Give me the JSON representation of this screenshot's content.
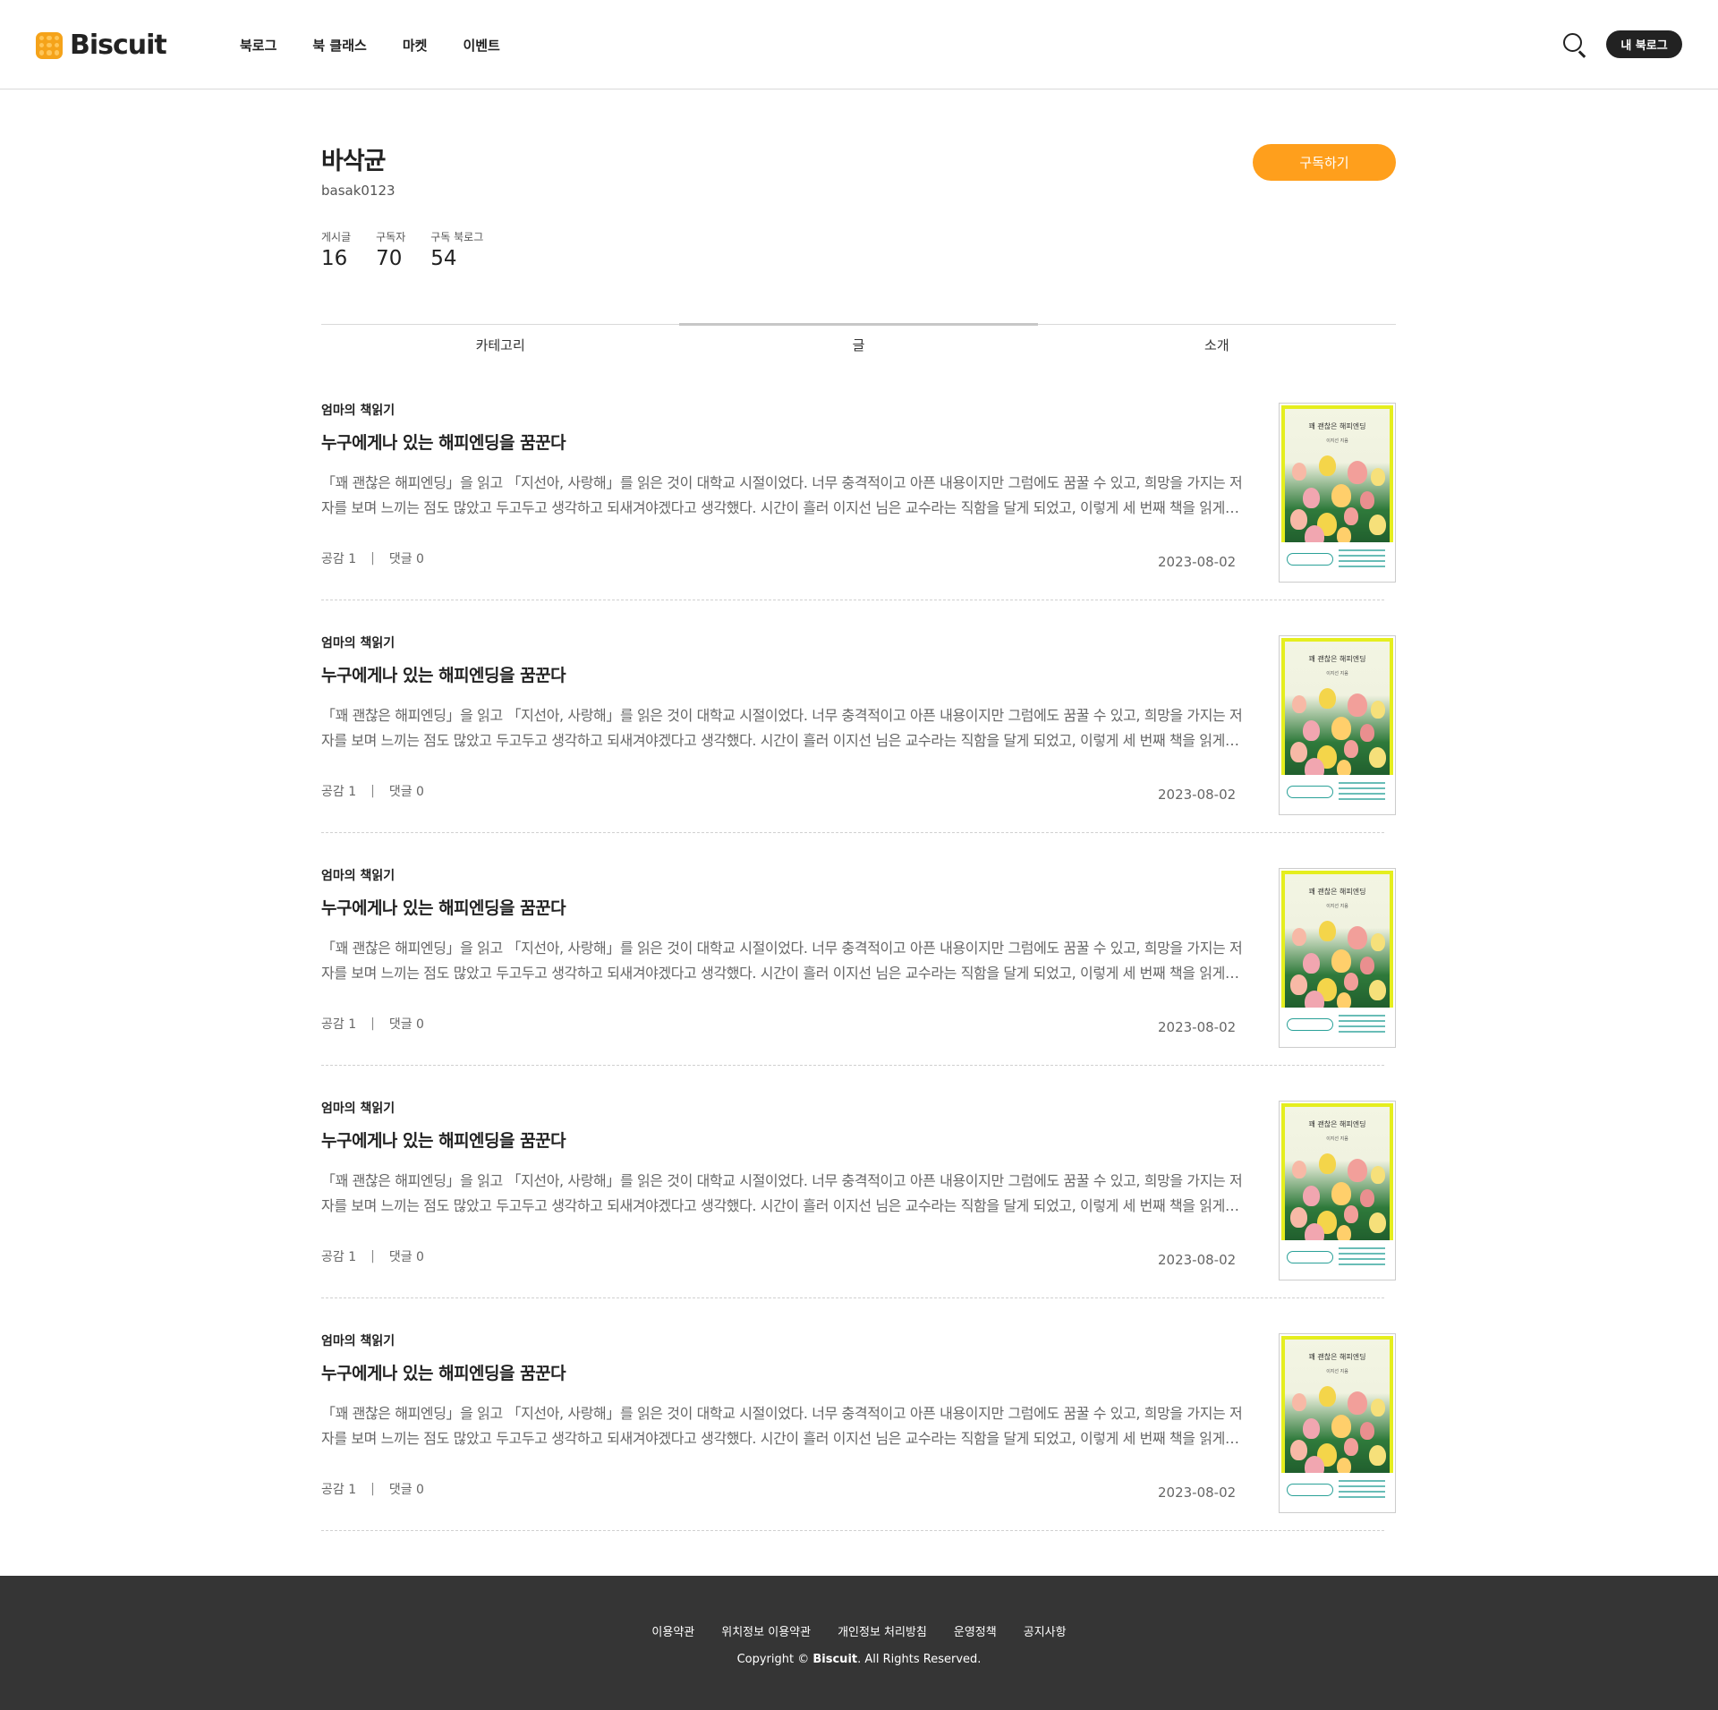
{
  "header": {
    "logo_text": "Biscuit",
    "nav": [
      "북로그",
      "북 클래스",
      "마켓",
      "이벤트"
    ],
    "my_booklog": "내 북로그"
  },
  "profile": {
    "name": "바삭균",
    "id": "basak0123",
    "subscribe_label": "구독하기",
    "stats": [
      {
        "label": "게시글",
        "value": "16"
      },
      {
        "label": "구독자",
        "value": "70"
      },
      {
        "label": "구독 북로그",
        "value": "54"
      }
    ]
  },
  "tabs": [
    {
      "label": "카테고리",
      "active": false
    },
    {
      "label": "글",
      "active": true
    },
    {
      "label": "소개",
      "active": false
    }
  ],
  "posts": [
    {
      "category": "엄마의 책읽기",
      "title": "누구에게나 있는 해피엔딩을 꿈꾼다",
      "excerpt": "「꽤 괜찮은 해피엔딩」을 읽고 「지선아, 사랑해」를 읽은 것이 대학교 시절이었다. 너무 충격적이고 아픈 내용이지만 그럼에도 꿈꿀 수 있고, 희망을 가지는 저자를 보며 느끼는 점도 많았고 두고두고 생각하고 되새겨야겠다고 생각했다. 시간이 흘러 이지선 님은 교수라는 직함을 달게 되었고, 이렇게 세 번째 책을 읽게 되었다.",
      "likes": "공감 1",
      "comments": "댓글 0",
      "date": "2023-08-02"
    },
    {
      "category": "엄마의 책읽기",
      "title": "누구에게나 있는 해피엔딩을 꿈꾼다",
      "excerpt": "「꽤 괜찮은 해피엔딩」을 읽고 「지선아, 사랑해」를 읽은 것이 대학교 시절이었다. 너무 충격적이고 아픈 내용이지만 그럼에도 꿈꿀 수 있고, 희망을 가지는 저자를 보며 느끼는 점도 많았고 두고두고 생각하고 되새겨야겠다고 생각했다. 시간이 흘러 이지선 님은 교수라는 직함을 달게 되었고, 이렇게 세 번째 책을 읽게 되었다.",
      "likes": "공감 1",
      "comments": "댓글 0",
      "date": "2023-08-02"
    },
    {
      "category": "엄마의 책읽기",
      "title": "누구에게나 있는 해피엔딩을 꿈꾼다",
      "excerpt": "「꽤 괜찮은 해피엔딩」을 읽고 「지선아, 사랑해」를 읽은 것이 대학교 시절이었다. 너무 충격적이고 아픈 내용이지만 그럼에도 꿈꿀 수 있고, 희망을 가지는 저자를 보며 느끼는 점도 많았고 두고두고 생각하고 되새겨야겠다고 생각했다. 시간이 흘러 이지선 님은 교수라는 직함을 달게 되었고, 이렇게 세 번째 책을 읽게 되었다.",
      "likes": "공감 1",
      "comments": "댓글 0",
      "date": "2023-08-02"
    },
    {
      "category": "엄마의 책읽기",
      "title": "누구에게나 있는 해피엔딩을 꿈꾼다",
      "excerpt": "「꽤 괜찮은 해피엔딩」을 읽고 「지선아, 사랑해」를 읽은 것이 대학교 시절이었다. 너무 충격적이고 아픈 내용이지만 그럼에도 꿈꿀 수 있고, 희망을 가지는 저자를 보며 느끼는 점도 많았고 두고두고 생각하고 되새겨야겠다고 생각했다. 시간이 흘러 이지선 님은 교수라는 직함을 달게 되었고, 이렇게 세 번째 책을 읽게 되었다.",
      "likes": "공감 1",
      "comments": "댓글 0",
      "date": "2023-08-02"
    },
    {
      "category": "엄마의 책읽기",
      "title": "누구에게나 있는 해피엔딩을 꿈꾼다",
      "excerpt": "「꽤 괜찮은 해피엔딩」을 읽고 「지선아, 사랑해」를 읽은 것이 대학교 시절이었다. 너무 충격적이고 아픈 내용이지만 그럼에도 꿈꿀 수 있고, 희망을 가지는 저자를 보며 느끼는 점도 많았고 두고두고 생각하고 되새겨야겠다고 생각했다. 시간이 흘러 이지선 님은 교수라는 직함을 달게 되었고, 이렇게 세 번째 책을 읽게 되었다.",
      "likes": "공감 1",
      "comments": "댓글 0",
      "date": "2023-08-02"
    }
  ],
  "book_cover": {
    "title": "꽤 괜찮은 해피엔딩",
    "author": "이지선 지음"
  },
  "footer": {
    "links": [
      "이용약관",
      "위치정보 이용약관",
      "개인정보 처리방침",
      "운영정책",
      "공지사항"
    ],
    "copyright_prefix": "Copyright ©",
    "copyright_brand": "Biscuit",
    "copyright_suffix": ". All Rights Reserved."
  },
  "colors": {
    "accent": "#ff9f1c",
    "dark": "#222222",
    "footer_bg": "#353535"
  }
}
